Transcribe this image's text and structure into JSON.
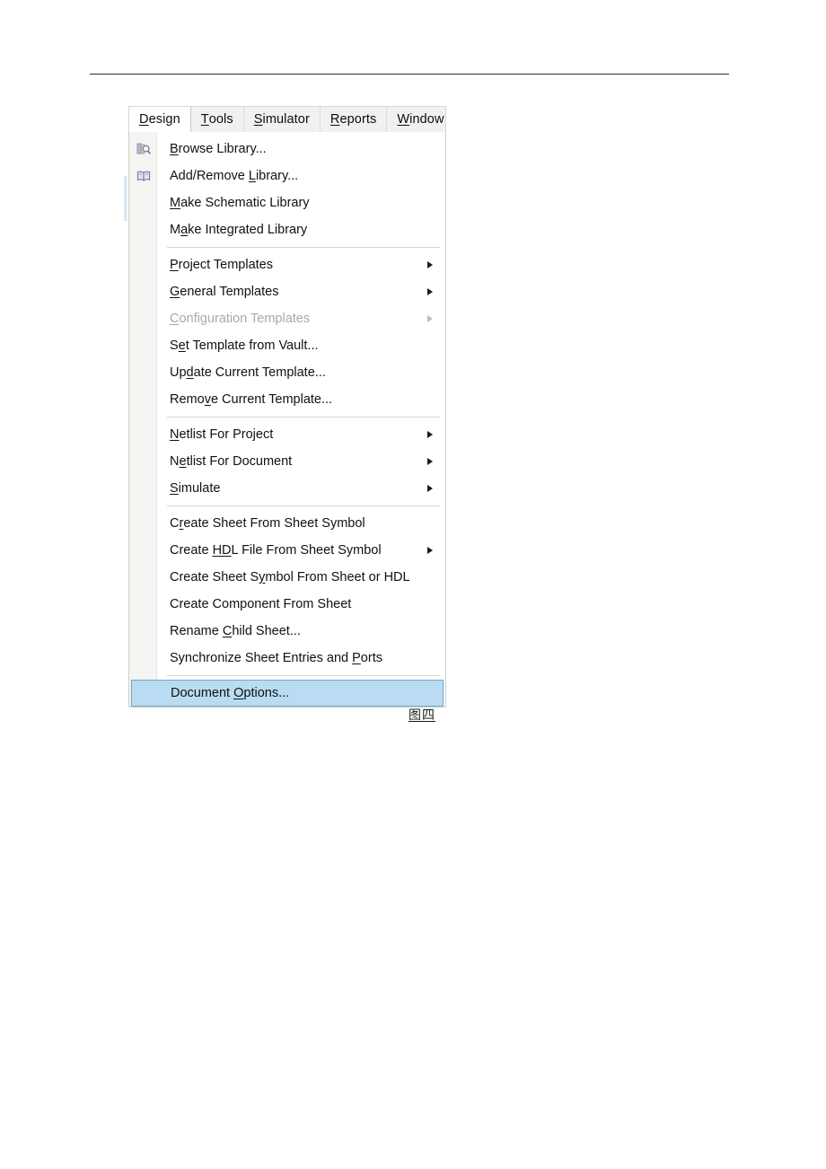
{
  "document": {
    "header_rule": true,
    "figure_caption": "图四"
  },
  "menubar": {
    "tabs": [
      {
        "label": "Design",
        "mnemonic": "D",
        "active": true
      },
      {
        "label": "Tools",
        "mnemonic": "T",
        "active": false
      },
      {
        "label": "Simulator",
        "mnemonic": "S",
        "active": false
      },
      {
        "label": "Reports",
        "mnemonic": "R",
        "active": false
      },
      {
        "label": "Window",
        "mnemonic": "W",
        "active": false
      }
    ]
  },
  "menu": {
    "name": "design-menu",
    "highlight_color": "#b9dcf2",
    "highlight_border_color": "#6fa8cf",
    "items": [
      {
        "type": "item",
        "label": "Browse Library...",
        "mnemonic": "B",
        "icon": "browse-library-icon",
        "submenu": false,
        "disabled": false,
        "highlighted": false
      },
      {
        "type": "item",
        "label": "Add/Remove Library...",
        "mnemonic": "L",
        "icon": "add-remove-library-icon",
        "submenu": false,
        "disabled": false,
        "highlighted": false
      },
      {
        "type": "item",
        "label": "Make Schematic Library",
        "mnemonic": "M",
        "icon": null,
        "submenu": false,
        "disabled": false,
        "highlighted": false
      },
      {
        "type": "item",
        "label": "Make Integrated Library",
        "mnemonic": "a",
        "icon": null,
        "submenu": false,
        "disabled": false,
        "highlighted": false
      },
      {
        "type": "separator"
      },
      {
        "type": "item",
        "label": "Project Templates",
        "mnemonic": "P",
        "icon": null,
        "submenu": true,
        "disabled": false,
        "highlighted": false
      },
      {
        "type": "item",
        "label": "General Templates",
        "mnemonic": "G",
        "icon": null,
        "submenu": true,
        "disabled": false,
        "highlighted": false
      },
      {
        "type": "item",
        "label": "Configuration Templates",
        "mnemonic": "C",
        "icon": null,
        "submenu": true,
        "disabled": true,
        "highlighted": false
      },
      {
        "type": "item",
        "label": "Set Template from Vault...",
        "mnemonic": "e",
        "icon": null,
        "submenu": false,
        "disabled": false,
        "highlighted": false
      },
      {
        "type": "item",
        "label": "Update Current Template...",
        "mnemonic": "d",
        "icon": null,
        "submenu": false,
        "disabled": false,
        "highlighted": false
      },
      {
        "type": "item",
        "label": "Remove Current Template...",
        "mnemonic": "v",
        "icon": null,
        "submenu": false,
        "disabled": false,
        "highlighted": false
      },
      {
        "type": "separator"
      },
      {
        "type": "item",
        "label": "Netlist For Project",
        "mnemonic": "N",
        "icon": null,
        "submenu": true,
        "disabled": false,
        "highlighted": false
      },
      {
        "type": "item",
        "label": "Netlist For Document",
        "mnemonic": "e",
        "icon": null,
        "submenu": true,
        "disabled": false,
        "highlighted": false
      },
      {
        "type": "item",
        "label": "Simulate",
        "mnemonic": "S",
        "icon": null,
        "submenu": true,
        "disabled": false,
        "highlighted": false
      },
      {
        "type": "separator"
      },
      {
        "type": "item",
        "label": "Create Sheet From Sheet Symbol",
        "mnemonic": "r",
        "icon": null,
        "submenu": false,
        "disabled": false,
        "highlighted": false
      },
      {
        "type": "item",
        "label": "Create HDL File From Sheet Symbol",
        "mnemonic": "HD",
        "icon": null,
        "submenu": true,
        "disabled": false,
        "highlighted": false
      },
      {
        "type": "item",
        "label": "Create Sheet Symbol From Sheet or HDL",
        "mnemonic": "y",
        "icon": null,
        "submenu": false,
        "disabled": false,
        "highlighted": false
      },
      {
        "type": "item",
        "label": "Create Component From Sheet",
        "mnemonic": null,
        "icon": null,
        "submenu": false,
        "disabled": false,
        "highlighted": false
      },
      {
        "type": "item",
        "label": "Rename Child Sheet...",
        "mnemonic": "C",
        "icon": null,
        "submenu": false,
        "disabled": false,
        "highlighted": false
      },
      {
        "type": "item",
        "label": "Synchronize Sheet Entries and Ports",
        "mnemonic": "P",
        "icon": null,
        "submenu": false,
        "disabled": false,
        "highlighted": false
      },
      {
        "type": "separator"
      },
      {
        "type": "item",
        "label": "Document Options...",
        "mnemonic": "O",
        "icon": null,
        "submenu": false,
        "disabled": false,
        "highlighted": true
      }
    ]
  }
}
